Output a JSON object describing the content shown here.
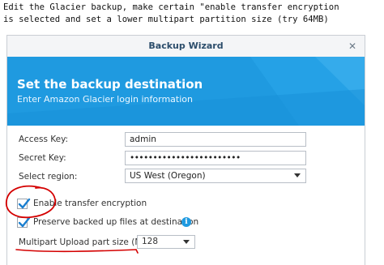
{
  "instruction": "Edit the Glacier backup, make certain \"enable transfer encryption\nis selected and set a lower multipart partition size (try 64MB)",
  "dialog": {
    "title": "Backup Wizard",
    "close_glyph": "✕",
    "banner_title": "Set the backup destination",
    "banner_subtitle": "Enter Amazon Glacier login information"
  },
  "form": {
    "access_key_label": "Access Key:",
    "access_key_value": "admin",
    "secret_key_label": "Secret Key:",
    "secret_key_value": "••••••••••••••••••••••••",
    "region_label": "Select region:",
    "region_value": "US West (Oregon)",
    "encryption_label": "Enable transfer encryption",
    "encryption_checked": true,
    "preserve_label": "Preserve backed up files at destination",
    "preserve_checked": true,
    "multipart_label": "Multipart Upload part size (MB):",
    "multipart_value": "128"
  },
  "icons": {
    "info": "info-icon",
    "dropdown": "chevron-down-icon",
    "check": "checkmark-icon"
  },
  "colors": {
    "banner": "#1f9ae0",
    "checkmark": "#1a7fd0",
    "annotation": "#d40000"
  }
}
